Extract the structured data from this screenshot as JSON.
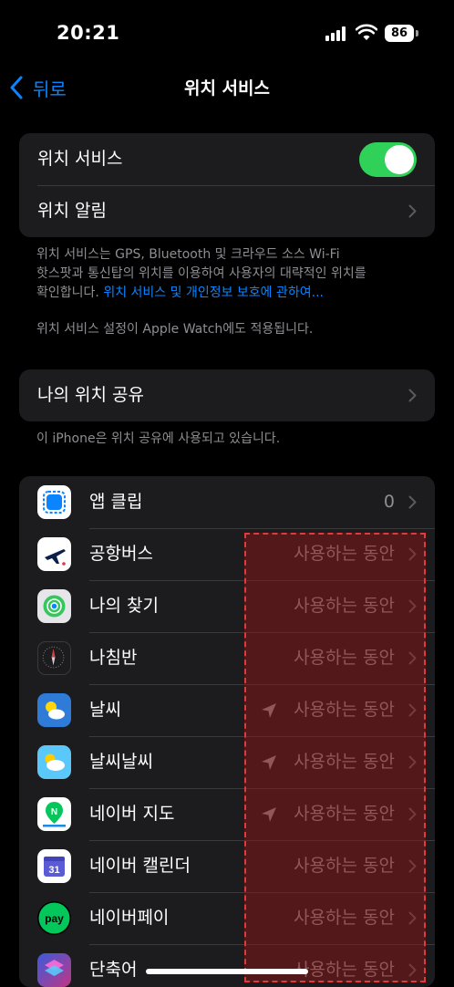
{
  "status_bar": {
    "time": "20:21",
    "battery": "86"
  },
  "nav": {
    "back_label": "뒤로",
    "title": "위치 서비스"
  },
  "location_services": {
    "toggle_label": "위치 서비스",
    "toggle_on": true,
    "alerts_label": "위치 알림"
  },
  "footnote1": {
    "line1": "위치 서비스는 GPS, Bluetooth 및 크라우드 소스 Wi-Fi",
    "line2": "핫스팟과 통신탑의 위치를 이용하여 사용자의 대략적인 위치를",
    "line3_prefix": "확인합니다. ",
    "line3_link": "위치 서비스 및 개인정보 보호에 관하여..."
  },
  "footnote2": "위치 서비스 설정이 Apple Watch에도 적용됩니다.",
  "share": {
    "label": "나의 위치 공유"
  },
  "footnote3": "이 iPhone은 위치 공유에 사용되고 있습니다.",
  "apps": [
    {
      "name": "앱 클립",
      "value": "0",
      "location_arrow": false,
      "icon": "app-clip-icon"
    },
    {
      "name": "공항버스",
      "value": "사용하는 동안",
      "location_arrow": false,
      "icon": "airplane-icon"
    },
    {
      "name": "나의 찾기",
      "value": "사용하는 동안",
      "location_arrow": false,
      "icon": "find-my-icon"
    },
    {
      "name": "나침반",
      "value": "사용하는 동안",
      "location_arrow": false,
      "icon": "compass-icon"
    },
    {
      "name": "날씨",
      "value": "사용하는 동안",
      "location_arrow": true,
      "icon": "weather-icon"
    },
    {
      "name": "날씨날씨",
      "value": "사용하는 동안",
      "location_arrow": true,
      "icon": "weather-cloud-icon"
    },
    {
      "name": "네이버 지도",
      "value": "사용하는 동안",
      "location_arrow": true,
      "icon": "naver-map-icon"
    },
    {
      "name": "네이버 캘린더",
      "value": "사용하는 동안",
      "location_arrow": false,
      "icon": "naver-calendar-icon"
    },
    {
      "name": "네이버페이",
      "value": "사용하는 동안",
      "location_arrow": false,
      "icon": "naver-pay-icon"
    },
    {
      "name": "단축어",
      "value": "사용하는 동안",
      "location_arrow": false,
      "icon": "shortcuts-icon"
    }
  ],
  "icon_text": {
    "calendar_day": "31",
    "pay": "pay",
    "naver_map": "N"
  },
  "colors": {
    "accent": "#0a84ff",
    "toggle_on": "#30d158",
    "highlight_border": "#e0393e"
  }
}
